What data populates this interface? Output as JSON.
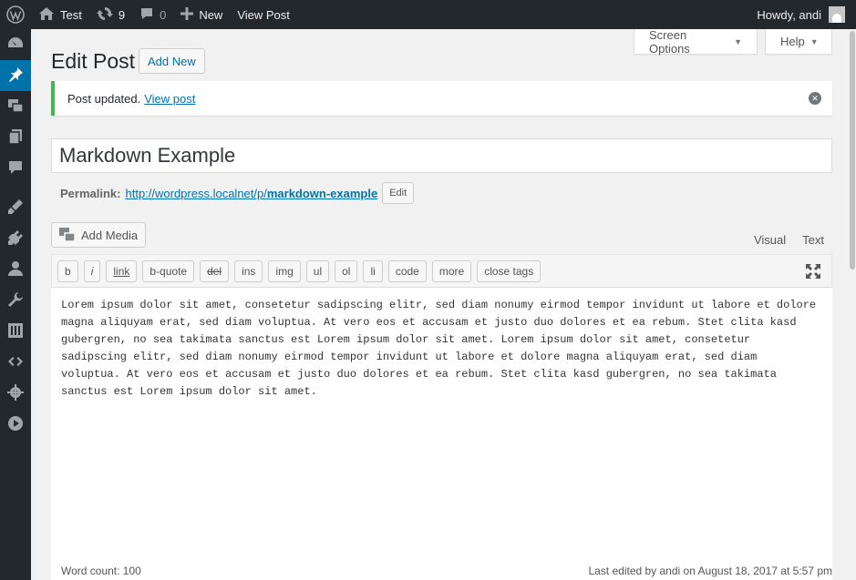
{
  "adminbar": {
    "site_name": "Test",
    "updates_count": "9",
    "comments_count": "0",
    "new_label": "New",
    "view_post_label": "View Post",
    "howdy": "Howdy, andi"
  },
  "screen_meta": {
    "screen_options": "Screen Options",
    "help": "Help"
  },
  "page": {
    "title": "Edit Post",
    "add_new": "Add New"
  },
  "notice": {
    "text": "Post updated.",
    "link": "View post"
  },
  "post": {
    "title": "Markdown Example",
    "permalink_label": "Permalink:",
    "permalink_base": "http://wordpress.localnet/p/",
    "permalink_slug": "markdown-example",
    "edit_label": "Edit"
  },
  "editor": {
    "add_media": "Add Media",
    "tab_visual": "Visual",
    "tab_text": "Text",
    "quicktags": [
      {
        "label": "b",
        "style": ""
      },
      {
        "label": "i",
        "style": "italic"
      },
      {
        "label": "link",
        "style": "underline"
      },
      {
        "label": "b-quote",
        "style": ""
      },
      {
        "label": "del",
        "style": "strike"
      },
      {
        "label": "ins",
        "style": ""
      },
      {
        "label": "img",
        "style": ""
      },
      {
        "label": "ul",
        "style": ""
      },
      {
        "label": "ol",
        "style": ""
      },
      {
        "label": "li",
        "style": ""
      },
      {
        "label": "code",
        "style": ""
      },
      {
        "label": "more",
        "style": ""
      },
      {
        "label": "close tags",
        "style": ""
      }
    ],
    "content": "Lorem ipsum dolor sit amet, consetetur sadipscing elitr, sed diam nonumy eirmod tempor invidunt ut labore et dolore magna aliquyam erat, sed diam voluptua. At vero eos et accusam et justo duo dolores et ea rebum. Stet clita kasd gubergren, no sea takimata sanctus est Lorem ipsum dolor sit amet. Lorem ipsum dolor sit amet, consetetur sadipscing elitr, sed diam nonumy eirmod tempor invidunt ut labore et dolore magna aliquyam erat, sed diam voluptua. At vero eos et accusam et justo duo dolores et ea rebum. Stet clita kasd gubergren, no sea takimata sanctus est Lorem ipsum dolor sit amet.",
    "word_count": "Word count: 100",
    "last_edited": "Last edited by andi on August 18, 2017 at 5:57 pm"
  },
  "colors": {
    "admin_bg": "#23282d",
    "accent": "#0073aa",
    "notice_success": "#46b450"
  }
}
